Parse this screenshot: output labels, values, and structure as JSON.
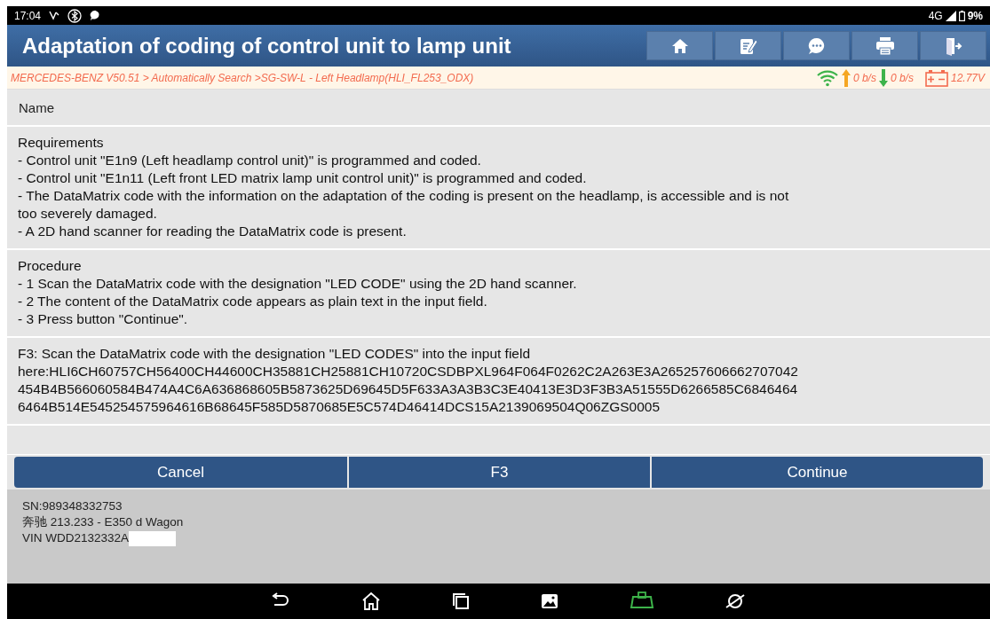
{
  "status_bar": {
    "time": "17:04",
    "network": "4G",
    "battery": "9%"
  },
  "header": {
    "title": "Adaptation of coding of control unit to lamp unit",
    "tools": [
      {
        "kind": "home"
      },
      {
        "kind": "edit"
      },
      {
        "kind": "chat"
      },
      {
        "kind": "print"
      },
      {
        "kind": "exit"
      }
    ]
  },
  "breadcrumb": {
    "path": "MERCEDES-BENZ V50.51 > Automatically Search >SG-SW-L - Left Headlamp(HLI_FL253_ODX)",
    "upload": "0 b/s",
    "download": "0 b/s",
    "voltage": "12.77V"
  },
  "name_header": "Name",
  "sections": [
    {
      "lines": [
        "Requirements",
        "- Control unit \"E1n9 (Left headlamp control unit)\" is programmed and coded.",
        "- Control unit \"E1n11 (Left front LED matrix lamp unit control unit)\" is programmed and coded.",
        "- The DataMatrix code with the information on the adaptation of the coding is present on the headlamp, is accessible and is not",
        "too severely damaged.",
        "- A 2D hand scanner for reading the DataMatrix code is present."
      ]
    },
    {
      "lines": [
        "Procedure",
        "- 1 Scan the DataMatrix code with the designation \"LED CODE\" using the 2D hand scanner.",
        "- 2 The content of the DataMatrix code appears as plain text in the input field.",
        "- 3 Press button \"Continue\"."
      ]
    },
    {
      "lines": [
        "F3: Scan the DataMatrix code with the designation \"LED CODES\" into the input field",
        "here:HLI6CH60757CH56400CH44600CH35881CH25881CH10720CSDBPXL964F064F0262C2A263E3A265257606662707042",
        "454B4B566060584B474A4C6A636868605B5873625D69645D5F633A3A3B3C3E40413E3D3F3B3A51555D6266585C6846464",
        "6464B514E545254575964616B68645F585D5870685E5C574D46414DCS15A2139069504Q06ZGS0005"
      ]
    }
  ],
  "buttons": [
    "Cancel",
    "F3",
    "Continue"
  ],
  "device": {
    "serial": "SN:989348332753",
    "vehicle": "奔驰 213.233 - E350 d Wagon",
    "vin": "VIN WDD2132332A"
  },
  "nav": [
    {
      "kind": "back"
    },
    {
      "kind": "home"
    },
    {
      "kind": "recents"
    },
    {
      "kind": "gallery"
    },
    {
      "kind": "vci"
    },
    {
      "kind": "browser"
    }
  ]
}
